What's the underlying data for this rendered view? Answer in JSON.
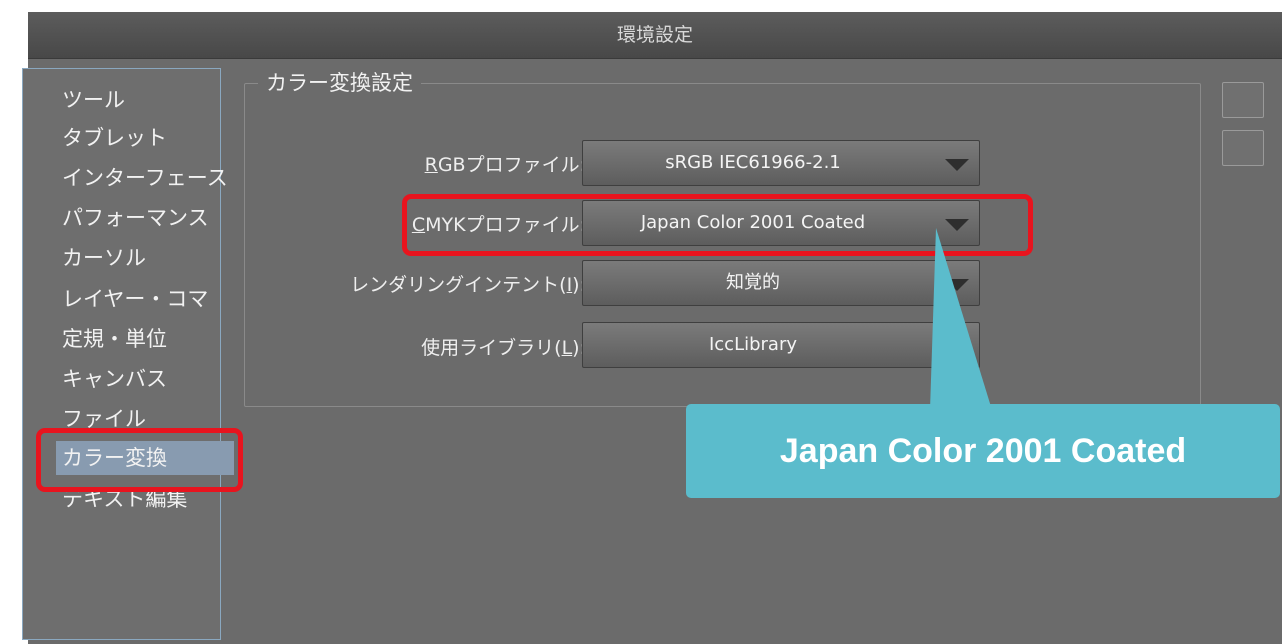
{
  "window": {
    "title": "環境設定"
  },
  "sidebar": {
    "items": [
      {
        "label": "ツール"
      },
      {
        "label": "タブレット"
      },
      {
        "label": "インターフェース"
      },
      {
        "label": "パフォーマンス"
      },
      {
        "label": "カーソル"
      },
      {
        "label": "レイヤー・コマ"
      },
      {
        "label": "定規・単位"
      },
      {
        "label": "キャンバス"
      },
      {
        "label": "ファイル"
      },
      {
        "label": "カラー変換"
      },
      {
        "label": "テキスト編集"
      }
    ],
    "selected": "カラー変換"
  },
  "color_settings": {
    "group_title": "カラー変換設定",
    "rgb_profile": {
      "label_key": "R",
      "label_rest": "GBプロファイル:",
      "value": "sRGB IEC61966-2.1"
    },
    "cmyk_profile": {
      "label_key": "C",
      "label_rest": "MYKプロファイル:",
      "value": "Japan Color 2001 Coated"
    },
    "rendering_intent": {
      "label_pre": "レンダリングインテント(",
      "label_key": "I",
      "label_post": "):",
      "value": "知覚的"
    },
    "library": {
      "label_pre": "使用ライブラリ(",
      "label_key": "L",
      "label_post": "):",
      "value": "IccLibrary"
    }
  },
  "annotation": {
    "callout_text": "Japan Color 2001 Coated",
    "highlight_color": "#e8141e",
    "callout_color": "#5bbccc"
  }
}
